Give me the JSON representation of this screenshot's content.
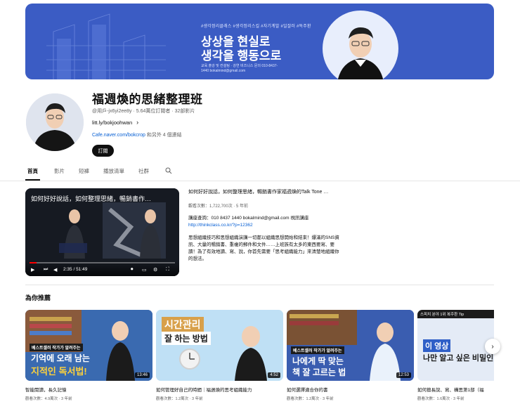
{
  "banner": {
    "tags": "#생각정리클래스 #생각정리스킬 #자기계발 #일잘러 #독주환",
    "line1": "상상을 현실로",
    "line2": "생각을 행동으로",
    "contact": "교육 출강 및 컨설팅 · 강연 비즈니스 문의 010-8437-1440 bokalmind@gmail.com",
    "accent": "#3b5cc4"
  },
  "channel": {
    "title": "福週煥的思緒整理班",
    "meta": "@用戶-jx6yi2ee8y · 5.64萬位訂閱者 · 32部影片",
    "link": "litt.ly/bokjoohwan",
    "links2_url": "Cafe.naver.com/bokcrop",
    "links2_more": " 和另外 4 個連結",
    "subscribe_label": "訂閱"
  },
  "tabs": [
    "首頁",
    "影片",
    "短褲",
    "播放清單",
    "社群"
  ],
  "featured": {
    "player_title": "如何好好說話，如何整理思緒，暢銷書作…",
    "time": "2:35 / 51:49",
    "progress": 0.05,
    "title": "如何好好說話，如何整理思緒，暢銷書作家福週煥的Talk Tone …",
    "meta": "觀看次數：1,722,700次 · 5 年前",
    "desc1": "講座查詢：010 8437 1440 bokalmind@gmail.com 視訊講座",
    "desc_url": "http://thinkclass.co.kr/?p=12362",
    "desc2": "思想組織技巧和思想組織演講一切都以組織思想開始和結束！爆滿的SNS資訊、大量的暢銷書、重複的郵件和文件……上班族有太多的東西要寫、要讀！為了有效地讀、寫、說，你首先需要「思考組織能力」來清楚地組織你的想法。"
  },
  "recommended": {
    "heading": "為你推薦",
    "videos": [
      {
        "title": "智能閱讀，長久記憶",
        "meta": "觀看次數：4.9萬次 · 3 年前",
        "duration": "13:46",
        "thumb_text1": "베스트셀러 작가가 알려주는",
        "thumb_text2": "기억에 오래 남는",
        "thumb_text3": "지적인 독서법!"
      },
      {
        "title": "如何管理好自己的時間｜福週煥的思考組織能力",
        "meta": "觀看次數：1.2萬次 · 3 年前",
        "duration": "4:52",
        "thumb_text1": "시간관리",
        "thumb_text2": "잘 하는 방법",
        "thumb_text3": ""
      },
      {
        "title": "如何選擇適合你的書",
        "meta": "觀看次數：1.2萬次 · 3 年前",
        "duration": "12:53",
        "thumb_text1": "베스트셀러 작가가 알려주는",
        "thumb_text2": "나에게 딱 맞는",
        "thumb_text3": "책 잘 고르는 법"
      },
      {
        "title": "如何擅長說、寫、構思第1部（福",
        "meta": "觀看次數：1.6萬次 · 3 年前",
        "duration": "",
        "thumb_text1": "스피치 분야 1위 복주환 Tip",
        "thumb_text2": "이 영상",
        "thumb_text3": "나만 알고 싶은 비밀인데요..."
      }
    ]
  }
}
